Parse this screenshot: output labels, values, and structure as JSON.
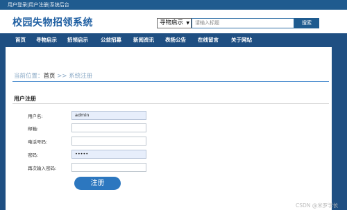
{
  "topbar": {
    "links": [
      "用户登录",
      "用户注册",
      "系统后台"
    ],
    "separator": "|"
  },
  "header": {
    "site_title": "校园失物招领系统",
    "search": {
      "category": "寻物启示",
      "placeholder": "请输入标题",
      "button": "搜索"
    }
  },
  "nav": {
    "items": [
      "首页",
      "寻物启示",
      "招领启示",
      "公益招募",
      "新闻资讯",
      "表扬公告",
      "在线留言",
      "关于网站"
    ]
  },
  "breadcrumb": {
    "prefix": "当前位置：",
    "home": "首页",
    "arrow": ">>",
    "current": "系统注册"
  },
  "form": {
    "title": "用户注册",
    "fields": [
      {
        "label": "用户名:",
        "value": "admin"
      },
      {
        "label": "邮箱:",
        "value": ""
      },
      {
        "label": "电话号码:",
        "value": ""
      },
      {
        "label": "密码:",
        "value": "•••••"
      },
      {
        "label": "再次输入密码:",
        "value": ""
      }
    ],
    "submit": "注册"
  },
  "watermark": "CSDN @米罗学长",
  "colors": {
    "primary": "#1f4f82",
    "accent": "#2c77bf",
    "title": "#1f5fa2"
  }
}
